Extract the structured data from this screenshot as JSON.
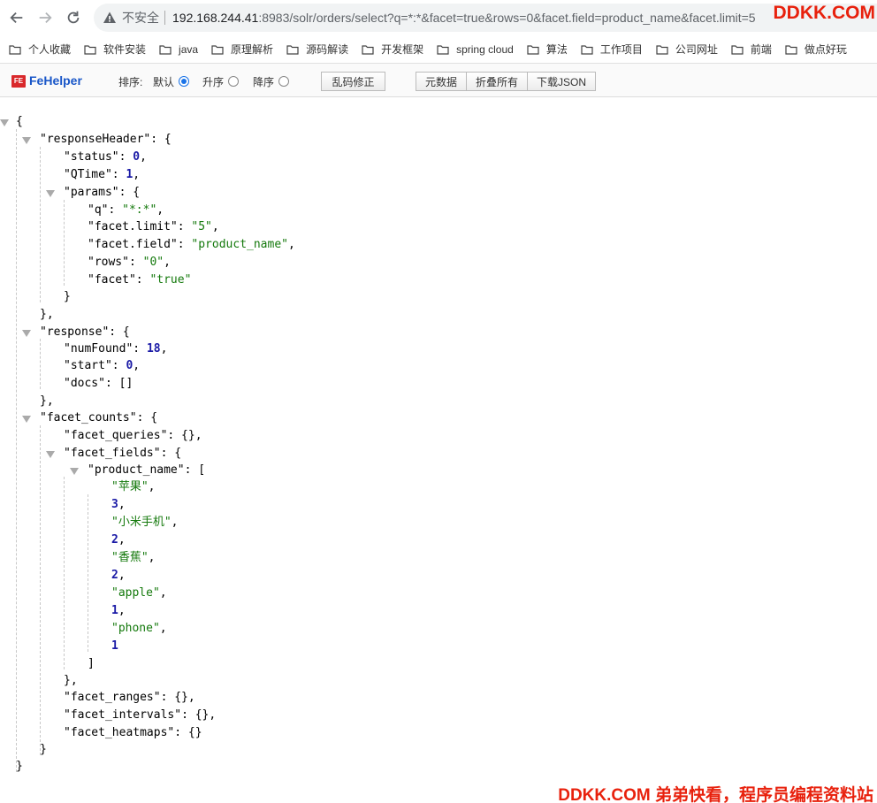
{
  "browser": {
    "security_label": "不安全",
    "url_host": "192.168.244.41",
    "url_rest": ":8983/solr/orders/select?q=*:*&facet=true&rows=0&facet.field=product_name&facet.limit=5",
    "watermark_top": "DDKK.COM"
  },
  "bookmarks": [
    "个人收藏",
    "软件安装",
    "java",
    "原理解析",
    "源码解读",
    "开发框架",
    "spring cloud",
    "算法",
    "工作项目",
    "公司网址",
    "前端",
    "做点好玩"
  ],
  "fehelper": {
    "logo": "FE",
    "brand": "FeHelper",
    "sort_label": "排序:",
    "opt_default": "默认",
    "opt_asc": "升序",
    "opt_desc": "降序",
    "fix_button": "乱码修正",
    "meta_button": "元数据",
    "fold_button": "折叠所有",
    "download_button": "下载JSON"
  },
  "json_lines": [
    "{",
    "\"responseHeader\": {",
    "\"status\": 0,",
    "\"QTime\": 1,",
    "\"params\": {",
    "\"q\": \"*:*\",",
    "\"facet.limit\": \"5\",",
    "\"facet.field\": \"product_name\",",
    "\"rows\": \"0\",",
    "\"facet\": \"true\"",
    "}",
    "},",
    "\"response\": {",
    "\"numFound\": 18,",
    "\"start\": 0,",
    "\"docs\": []",
    "},",
    "\"facet_counts\": {",
    "\"facet_queries\": {},",
    "\"facet_fields\": {",
    "\"product_name\": [",
    "\"苹果\",",
    "3,",
    "\"小米手机\",",
    "2,",
    "\"香蕉\",",
    "2,",
    "\"apple\",",
    "1,",
    "\"phone\",",
    "1",
    "]",
    "},",
    "\"facet_ranges\": {},",
    "\"facet_intervals\": {},",
    "\"facet_heatmaps\": {}",
    "}",
    "}"
  ],
  "watermark_bottom": "DDKK.COM 弟弟快看，程序员编程资料站"
}
